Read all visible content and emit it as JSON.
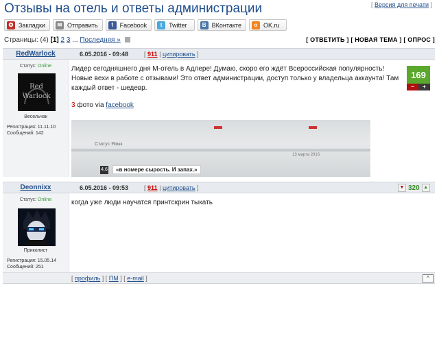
{
  "page": {
    "title": "Отзывы на отель и ответы администрации",
    "print_link": "Версия для печати"
  },
  "share": [
    {
      "label": "Закладки",
      "icon": "bookmark-icon",
      "color": "#c0302a",
      "glyph": "✪"
    },
    {
      "label": "Отправить",
      "icon": "mail-icon",
      "color": "#8a8a8a",
      "glyph": "✉"
    },
    {
      "label": "Facebook",
      "icon": "facebook-icon",
      "color": "#3b5998",
      "glyph": "f"
    },
    {
      "label": "Twitter",
      "icon": "twitter-icon",
      "color": "#4aa8e0",
      "glyph": "t"
    },
    {
      "label": "ВКонтакте",
      "icon": "vkontakte-icon",
      "color": "#4a76a8",
      "glyph": "B"
    },
    {
      "label": "OK.ru",
      "icon": "ok-icon",
      "color": "#f58220",
      "glyph": "o"
    }
  ],
  "pagination": {
    "prefix": "Страницы:",
    "count": "(4)",
    "current": "[1]",
    "page2": "2",
    "page3": "3",
    "ellipsis": "...",
    "last": "Последняя »"
  },
  "actions": {
    "reply": "[ ОТВЕТИТЬ ]",
    "new_topic": "[ НОВАЯ ТЕМА ]",
    "poll": "[ ОПРОС ]"
  },
  "posts": [
    {
      "author": "RedWarlock",
      "date": "6.05.2016 - 09:48",
      "num_pre": "[",
      "num": "911",
      "num_mid": "|",
      "quote": "цитировать",
      "num_post": "]",
      "status_label": "Статус:",
      "status": "Online",
      "rank": "Весельчак",
      "reg": "Регистрация: 11.11.10\nСообщений: 142",
      "text": "Лидер сегодняшнего дня М-отель в Адлере! Думаю, скоро его ждёт Всероссийская популярность! Новые вехи в работе с отзывами! Это ответ администрации, доступ только у владельца аккаунта! Там каждый ответ - шедевр.",
      "photos_count": "3",
      "photos_text": "фото via",
      "photos_link": "facebook",
      "rating": "169",
      "minus": "−",
      "plus": "+",
      "photo": {
        "caption": "«в номере сырость. И запах.»",
        "num": "4.6",
        "date": "13 марта 2016",
        "t1": "Статус     Язык"
      }
    },
    {
      "author": "Deonnixx",
      "date": "6.05.2016 - 09:53",
      "num_pre": "[",
      "num": "911",
      "num_mid": "|",
      "quote": "цитировать",
      "num_post": "]",
      "status_label": "Статус:",
      "status": "Online",
      "rank": "Приколист",
      "reg": "Регистрация: 15.05.14\nСообщений: 251",
      "text": "когда уже люди научатся принтскрин тыкать",
      "rating": "320"
    }
  ],
  "footer": {
    "profile": "профиль",
    "pm": "ПМ",
    "email": "e-mail",
    "top": "^"
  },
  "colors": {
    "accent": "#1f4e8c",
    "online": "#3a9a3a",
    "rating_bg": "#5aa82c",
    "minus_bg": "#b01010"
  }
}
